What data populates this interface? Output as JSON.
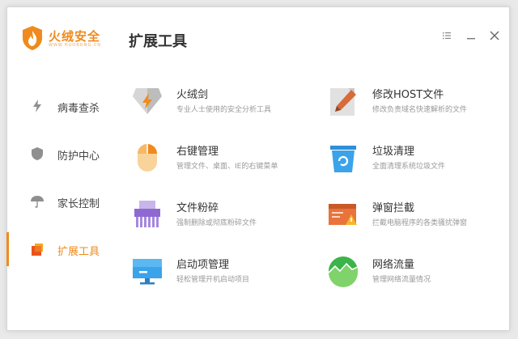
{
  "app": {
    "brand_name": "火绒安全",
    "brand_sub": "WWW.HUORONG.CN",
    "page_title": "扩展工具"
  },
  "window_controls": {
    "menu_icon": "menu-icon",
    "minimize_icon": "minimize-icon",
    "close_icon": "close-icon"
  },
  "sidebar": {
    "items": [
      {
        "label": "病毒查杀",
        "icon": "lightning-icon",
        "active": false
      },
      {
        "label": "防护中心",
        "icon": "shield-icon",
        "active": false
      },
      {
        "label": "家长控制",
        "icon": "umbrella-icon",
        "active": false
      },
      {
        "label": "扩展工具",
        "icon": "toolbox-icon",
        "active": true
      }
    ]
  },
  "tools": [
    {
      "name": "火绒剑",
      "desc": "专业人士使用的安全分析工具",
      "icon": "sword-shield-icon"
    },
    {
      "name": "修改HOST文件",
      "desc": "修改负责域名快速解析的文件",
      "icon": "edit-file-icon"
    },
    {
      "name": "右键管理",
      "desc": "管理文件、桌面、IE的右键菜单",
      "icon": "mouse-icon"
    },
    {
      "name": "垃圾清理",
      "desc": "全面清理系统垃圾文件",
      "icon": "trash-can-icon"
    },
    {
      "name": "文件粉碎",
      "desc": "强制删除或彻底粉碎文件",
      "icon": "shredder-icon"
    },
    {
      "name": "弹窗拦截",
      "desc": "拦截电脑程序的各类骚扰弹窗",
      "icon": "popup-block-icon"
    },
    {
      "name": "启动项管理",
      "desc": "轻松管理开机启动项目",
      "icon": "monitor-icon"
    },
    {
      "name": "网络流量",
      "desc": "管理网络流量情况",
      "icon": "network-chart-icon"
    }
  ],
  "colors": {
    "accent": "#f08a1c",
    "text": "#333333",
    "muted": "#999999"
  }
}
